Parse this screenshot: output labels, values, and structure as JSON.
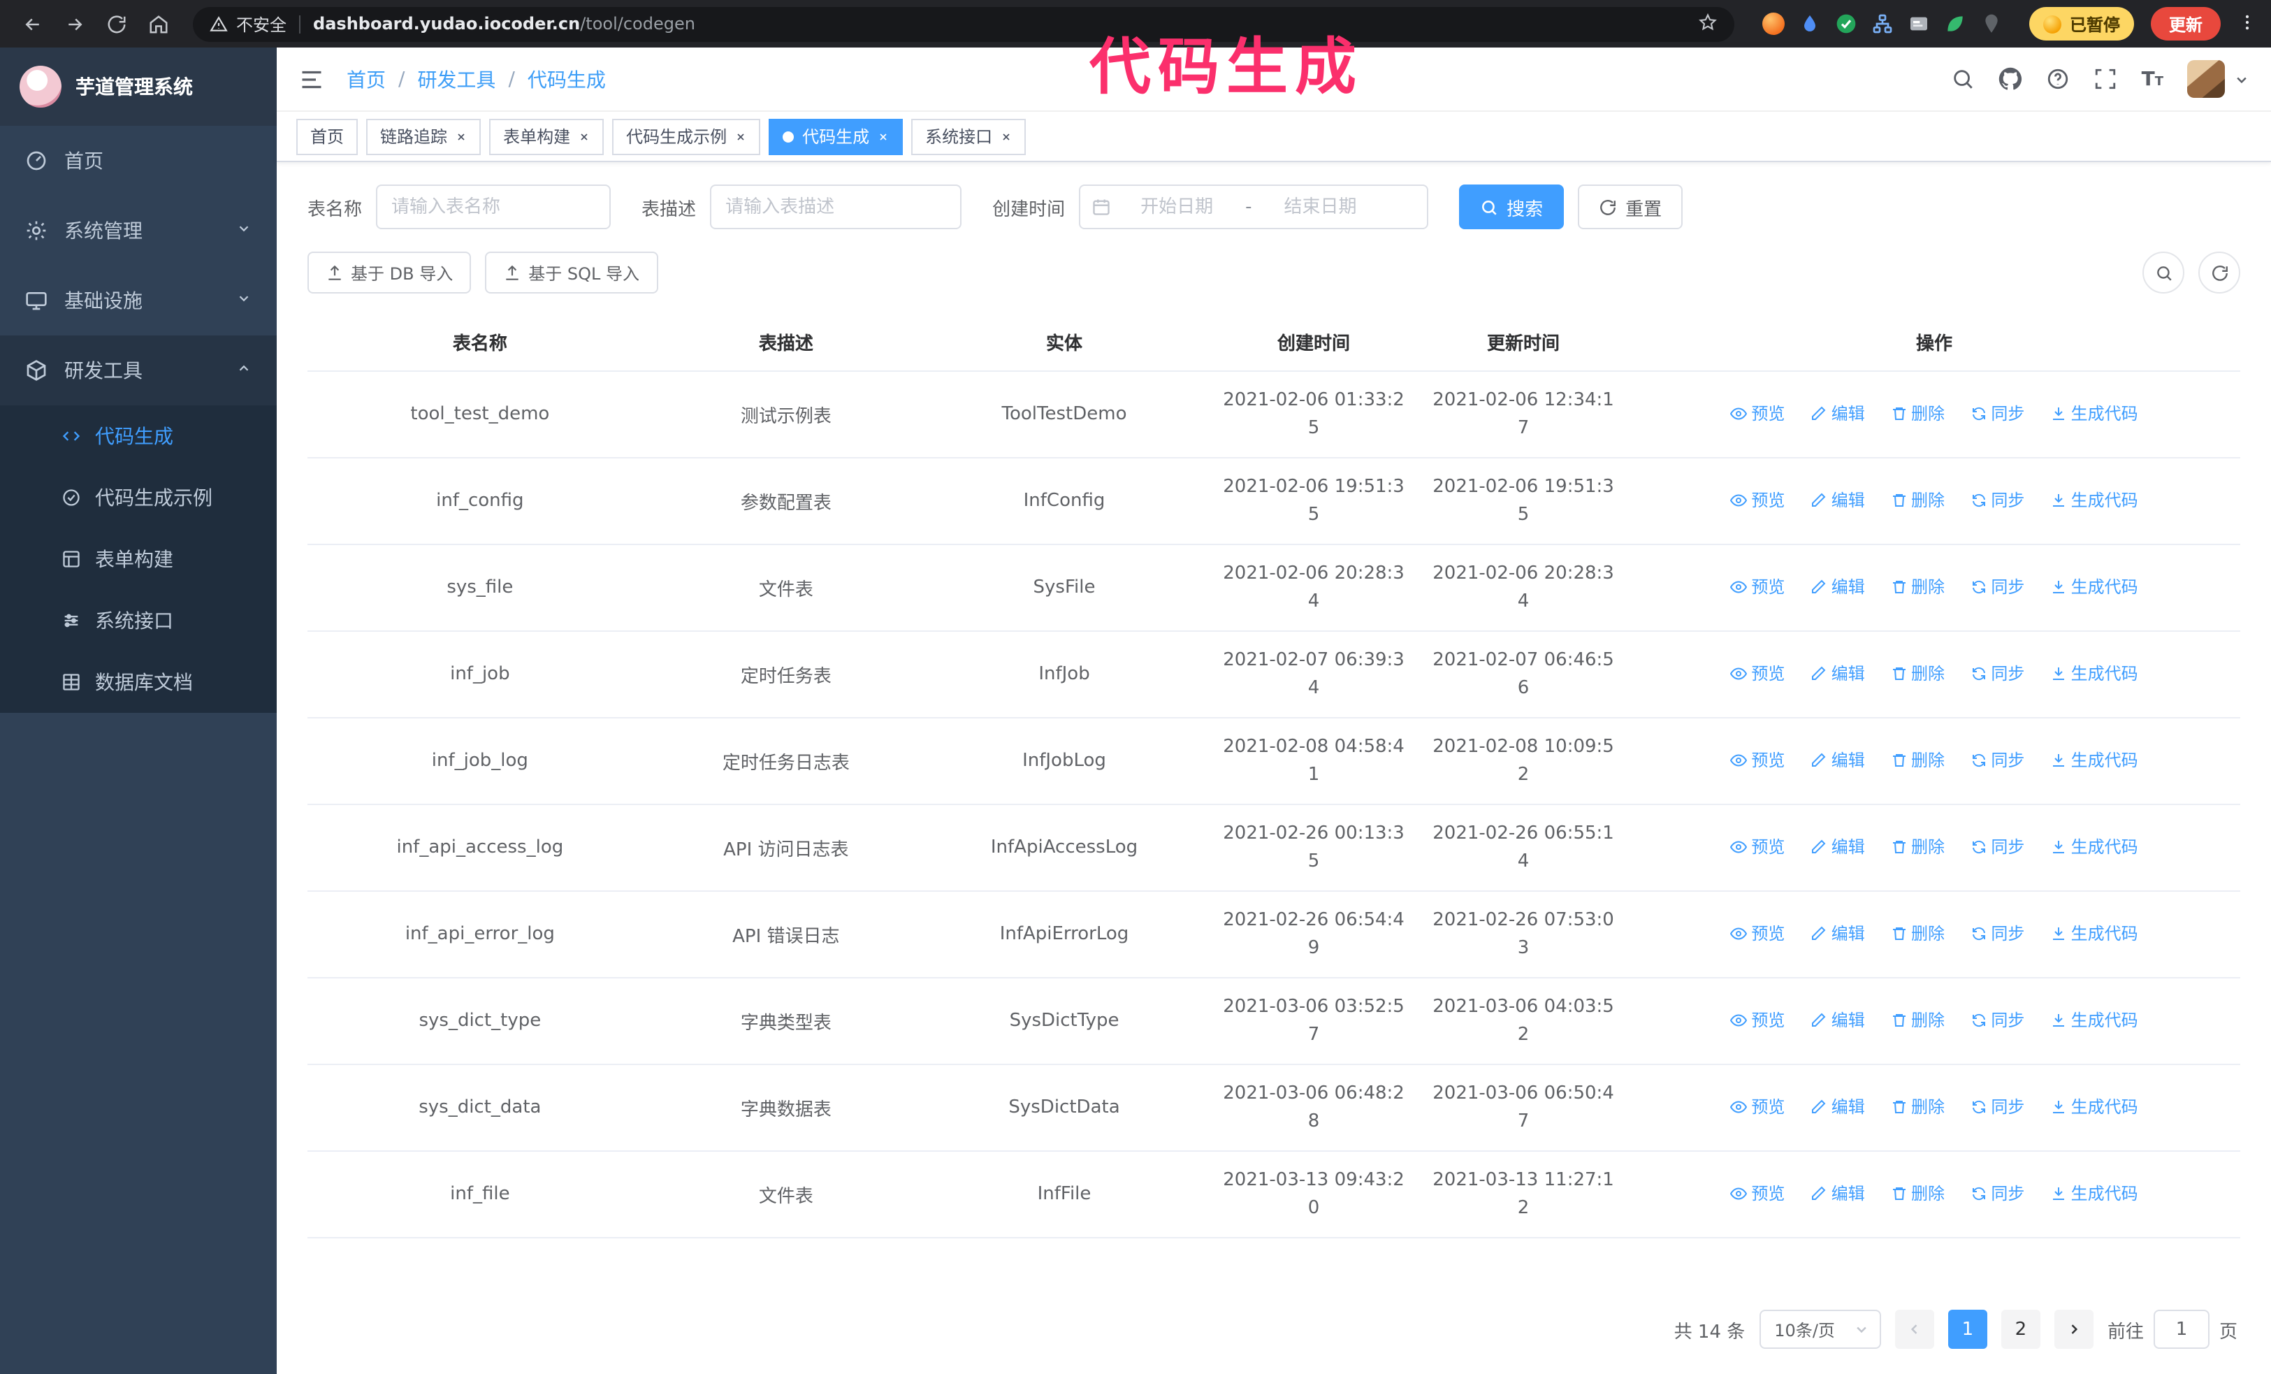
{
  "annotation": "代码生成",
  "colors": {
    "accent": "#409eff",
    "annotation": "#fb2f6c",
    "sidebar_bg": "#304156",
    "chrome_bg": "#232428"
  },
  "browser": {
    "security_warning": "不安全",
    "url_domain": "dashboard.yudao.iocoder.cn",
    "url_path": "/tool/codegen",
    "paused_badge": "已暂停",
    "update_button": "更新"
  },
  "sidebar": {
    "app_title": "芋道管理系统",
    "items": [
      {
        "label": "首页",
        "expandable": false
      },
      {
        "label": "系统管理",
        "expandable": true,
        "expanded": false
      },
      {
        "label": "基础设施",
        "expandable": true,
        "expanded": false
      },
      {
        "label": "研发工具",
        "expandable": true,
        "expanded": true
      }
    ],
    "subitems": [
      {
        "label": "代码生成",
        "active": true
      },
      {
        "label": "代码生成示例",
        "active": false
      },
      {
        "label": "表单构建",
        "active": false
      },
      {
        "label": "系统接口",
        "active": false
      },
      {
        "label": "数据库文档",
        "active": false
      }
    ]
  },
  "header": {
    "breadcrumb": [
      "首页",
      "研发工具",
      "代码生成"
    ]
  },
  "tabs": [
    {
      "label": "首页",
      "closable": false,
      "active": false
    },
    {
      "label": "链路追踪",
      "closable": true,
      "active": false
    },
    {
      "label": "表单构建",
      "closable": true,
      "active": false
    },
    {
      "label": "代码生成示例",
      "closable": true,
      "active": false
    },
    {
      "label": "代码生成",
      "closable": true,
      "active": true
    },
    {
      "label": "系统接口",
      "closable": true,
      "active": false
    }
  ],
  "filters": {
    "table_name_label": "表名称",
    "table_name_placeholder": "请输入表名称",
    "table_desc_label": "表描述",
    "table_desc_placeholder": "请输入表描述",
    "create_time_label": "创建时间",
    "date_start_placeholder": "开始日期",
    "date_separator": "-",
    "date_end_placeholder": "结束日期",
    "search_button": "搜索",
    "reset_button": "重置"
  },
  "toolbar": {
    "import_db": "基于 DB 导入",
    "import_sql": "基于 SQL 导入"
  },
  "table": {
    "columns": [
      "表名称",
      "表描述",
      "实体",
      "创建时间",
      "更新时间",
      "操作"
    ],
    "actions": [
      "预览",
      "编辑",
      "删除",
      "同步",
      "生成代码"
    ],
    "rows": [
      {
        "name": "tool_test_demo",
        "desc": "测试示例表",
        "entity": "ToolTestDemo",
        "created": "2021-02-06 01:33:25",
        "updated": "2021-02-06 12:34:17"
      },
      {
        "name": "inf_config",
        "desc": "参数配置表",
        "entity": "InfConfig",
        "created": "2021-02-06 19:51:35",
        "updated": "2021-02-06 19:51:35"
      },
      {
        "name": "sys_file",
        "desc": "文件表",
        "entity": "SysFile",
        "created": "2021-02-06 20:28:34",
        "updated": "2021-02-06 20:28:34"
      },
      {
        "name": "inf_job",
        "desc": "定时任务表",
        "entity": "InfJob",
        "created": "2021-02-07 06:39:34",
        "updated": "2021-02-07 06:46:56"
      },
      {
        "name": "inf_job_log",
        "desc": "定时任务日志表",
        "entity": "InfJobLog",
        "created": "2021-02-08 04:58:41",
        "updated": "2021-02-08 10:09:52"
      },
      {
        "name": "inf_api_access_log",
        "desc": "API 访问日志表",
        "entity": "InfApiAccessLog",
        "created": "2021-02-26 00:13:35",
        "updated": "2021-02-26 06:55:14"
      },
      {
        "name": "inf_api_error_log",
        "desc": "API 错误日志",
        "entity": "InfApiErrorLog",
        "created": "2021-02-26 06:54:49",
        "updated": "2021-02-26 07:53:03"
      },
      {
        "name": "sys_dict_type",
        "desc": "字典类型表",
        "entity": "SysDictType",
        "created": "2021-03-06 03:52:57",
        "updated": "2021-03-06 04:03:52"
      },
      {
        "name": "sys_dict_data",
        "desc": "字典数据表",
        "entity": "SysDictData",
        "created": "2021-03-06 06:48:28",
        "updated": "2021-03-06 06:50:47"
      },
      {
        "name": "inf_file",
        "desc": "文件表",
        "entity": "InfFile",
        "created": "2021-03-13 09:43:20",
        "updated": "2021-03-13 11:27:12"
      }
    ]
  },
  "pagination": {
    "total": "共 14 条",
    "page_size": "10条/页",
    "pages": [
      "1",
      "2"
    ],
    "active_page": "1",
    "goto_label": "前往",
    "goto_value": "1",
    "goto_suffix": "页"
  }
}
